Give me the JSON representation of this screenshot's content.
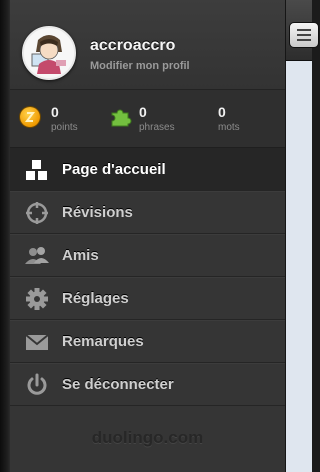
{
  "profile": {
    "username": "accroaccro",
    "edit_link": "Modifier mon profil"
  },
  "stats": [
    {
      "value": "0",
      "label": "points",
      "icon": "coin-icon"
    },
    {
      "value": "0",
      "label": "phrases",
      "icon": "puzzle-icon"
    },
    {
      "value": "0",
      "label": "mots",
      "icon": ""
    }
  ],
  "nav": {
    "items": [
      {
        "label": "Page d'accueil",
        "icon": "home-blocks-icon",
        "active": true
      },
      {
        "label": "Révisions",
        "icon": "crosshair-icon",
        "active": false
      },
      {
        "label": "Amis",
        "icon": "friends-icon",
        "active": false
      },
      {
        "label": "Réglages",
        "icon": "gear-icon",
        "active": false
      },
      {
        "label": "Remarques",
        "icon": "envelope-icon",
        "active": false
      },
      {
        "label": "Se déconnecter",
        "icon": "power-icon",
        "active": false
      }
    ]
  },
  "footer": {
    "logo_text": "duolingo.com"
  },
  "colors": {
    "panel": "#353535",
    "active_item": "#262626",
    "accent_green": "#6fbf3a",
    "accent_orange": "#f5a800"
  }
}
